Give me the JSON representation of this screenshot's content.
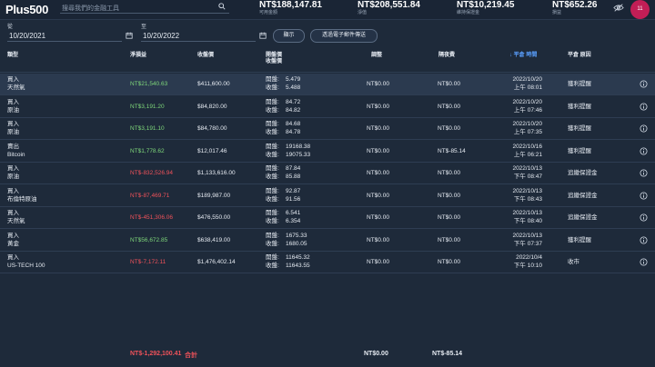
{
  "header": {
    "logo": "Plus500",
    "search_placeholder": "搜尋我們的金融工具",
    "stats": [
      {
        "value": "NT$188,147.81",
        "label": "可用金額"
      },
      {
        "value": "NT$208,551.84",
        "label": "淨值"
      },
      {
        "value": "NT$10,219.45",
        "label": "維持保證金"
      },
      {
        "value": "NT$652.26",
        "label": "損益"
      }
    ],
    "badge": "11"
  },
  "filters": {
    "from_label": "從",
    "from_value": "10/20/2021",
    "to_label": "至",
    "to_value": "10/20/2022",
    "show_button": "顯示",
    "email_button": "透過電子郵件傳送"
  },
  "columns": {
    "type": "類型",
    "net_pl": "淨損益",
    "close_amount": "收盤價",
    "open_close_line1": "開盤價",
    "open_close_line2": "收盤價",
    "adjust": "調整",
    "overnight": "隔夜費",
    "close_time": "平倉 時間",
    "close_reason": "平倉 原因"
  },
  "rows": [
    {
      "action": "買入",
      "instrument": "天然氣",
      "pl": "NT$21,540.63",
      "pl_sign": "pos",
      "amount": "$411,600.00",
      "open_label": "開盤:",
      "open": "5.479",
      "close_label": "收盤:",
      "close": "5.488",
      "adjust": "NT$0.00",
      "overnight": "NT$0.00",
      "date": "2022/10/20",
      "time": "上午 08:01",
      "reason": "獲利提醒"
    },
    {
      "action": "買入",
      "instrument": "原油",
      "pl": "NT$3,191.20",
      "pl_sign": "pos",
      "amount": "$84,820.00",
      "open_label": "開盤:",
      "open": "84.72",
      "close_label": "收盤:",
      "close": "84.82",
      "adjust": "NT$0.00",
      "overnight": "NT$0.00",
      "date": "2022/10/20",
      "time": "上午 07:46",
      "reason": "獲利提醒"
    },
    {
      "action": "買入",
      "instrument": "原油",
      "pl": "NT$3,191.10",
      "pl_sign": "pos",
      "amount": "$84,780.00",
      "open_label": "開盤:",
      "open": "84.68",
      "close_label": "收盤:",
      "close": "84.78",
      "adjust": "NT$0.00",
      "overnight": "NT$0.00",
      "date": "2022/10/20",
      "time": "上午 07:35",
      "reason": "獲利提醒"
    },
    {
      "action": "賣出",
      "instrument": "Bitcoin",
      "pl": "NT$1,778.62",
      "pl_sign": "pos",
      "amount": "$12,017.46",
      "open_label": "開盤:",
      "open": "19168.38",
      "close_label": "收盤:",
      "close": "19075.33",
      "adjust": "NT$0.00",
      "overnight": "NT$-85.14",
      "date": "2022/10/16",
      "time": "上午 06:21",
      "reason": "獲利提醒"
    },
    {
      "action": "買入",
      "instrument": "原油",
      "pl": "NT$-832,526.94",
      "pl_sign": "neg",
      "amount": "$1,133,616.00",
      "open_label": "開盤:",
      "open": "87.84",
      "close_label": "收盤:",
      "close": "85.88",
      "adjust": "NT$0.00",
      "overnight": "NT$0.00",
      "date": "2022/10/13",
      "time": "下午 08:47",
      "reason": "追繳保證金"
    },
    {
      "action": "買入",
      "instrument": "布倫特原油",
      "pl": "NT$-87,469.71",
      "pl_sign": "neg",
      "amount": "$189,987.00",
      "open_label": "開盤:",
      "open": "92.87",
      "close_label": "收盤:",
      "close": "91.56",
      "adjust": "NT$0.00",
      "overnight": "NT$0.00",
      "date": "2022/10/13",
      "time": "下午 08:43",
      "reason": "追繳保證金"
    },
    {
      "action": "買入",
      "instrument": "天然氣",
      "pl": "NT$-451,306.06",
      "pl_sign": "neg",
      "amount": "$476,550.00",
      "open_label": "開盤:",
      "open": "6.541",
      "close_label": "收盤:",
      "close": "6.354",
      "adjust": "NT$0.00",
      "overnight": "NT$0.00",
      "date": "2022/10/13",
      "time": "下午 08:40",
      "reason": "追繳保證金"
    },
    {
      "action": "買入",
      "instrument": "黃金",
      "pl": "NT$56,672.85",
      "pl_sign": "pos",
      "amount": "$638,419.00",
      "open_label": "開盤:",
      "open": "1675.33",
      "close_label": "收盤:",
      "close": "1680.05",
      "adjust": "NT$0.00",
      "overnight": "NT$0.00",
      "date": "2022/10/13",
      "time": "下午 07:37",
      "reason": "獲利提醒"
    },
    {
      "action": "買入",
      "instrument": "US-TECH 100",
      "pl": "NT$-7,172.11",
      "pl_sign": "neg",
      "amount": "$1,476,402.14",
      "open_label": "開盤:",
      "open": "11645.32",
      "close_label": "收盤:",
      "close": "11643.55",
      "adjust": "NT$0.00",
      "overnight": "NT$0.00",
      "date": "2022/10/4",
      "time": "下午 10:10",
      "reason": "收市"
    }
  ],
  "footer": {
    "total_pl": "NT$-1,292,100.41",
    "total_label": "合計",
    "total_adjust": "NT$0.00",
    "total_overnight": "NT$-85.14"
  },
  "colors": {
    "positive": "#7ed67a",
    "negative": "#f0525a",
    "accent": "#5aa0ff",
    "badge": "#c21e56"
  }
}
